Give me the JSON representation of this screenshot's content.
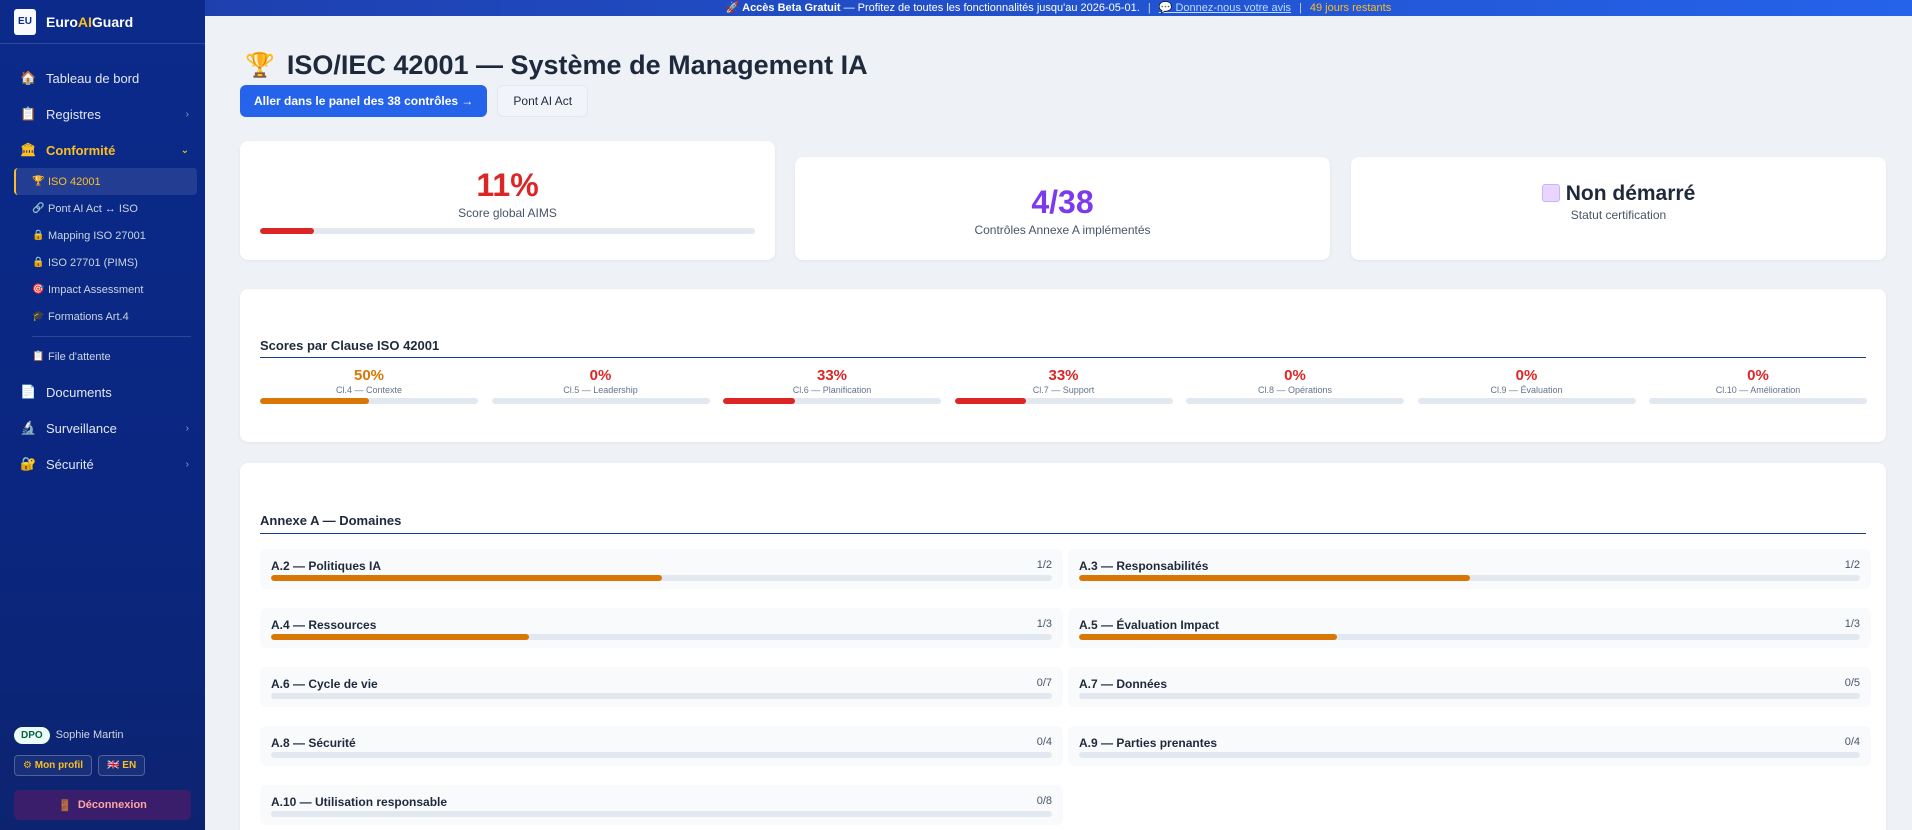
{
  "brand": {
    "logo_text": "EU",
    "name_prefix": "Euro",
    "name_ai": "AI",
    "name_suffix": "Guard"
  },
  "banner": {
    "bold": "🚀 Accès Beta Gratuit",
    "text": " — Profitez de toutes les fonctionnalités jusqu'au 2026-05-01.",
    "sep": "|",
    "feedback_link": "💬 Donnez-nous votre avis",
    "days_left": "49 jours restants"
  },
  "sidebar": {
    "items": [
      {
        "label": "Tableau de bord",
        "icon": "🏠"
      },
      {
        "label": "Registres",
        "icon": "📋"
      },
      {
        "label": "Conformité",
        "icon": "🏛"
      },
      {
        "label": "Documents",
        "icon": "📄"
      },
      {
        "label": "Surveillance",
        "icon": "🔬"
      },
      {
        "label": "Sécurité",
        "icon": "🔐"
      }
    ],
    "sub_items": [
      {
        "label": "ISO 42001",
        "icon": "🏆"
      },
      {
        "label": "Pont AI Act ↔ ISO",
        "icon": "🔗"
      },
      {
        "label": "Mapping ISO 27001",
        "icon": "🔒"
      },
      {
        "label": "ISO 27701 (PIMS)",
        "icon": "🔒"
      },
      {
        "label": "Impact Assessment",
        "icon": "🎯"
      },
      {
        "label": "Formations Art.4",
        "icon": "🎓"
      },
      {
        "label": "File d'attente",
        "icon": "📋"
      }
    ],
    "chevron": "›",
    "chevron_open": "⌄"
  },
  "user": {
    "role": "DPO",
    "name": "Sophie Martin",
    "profile_button": "⚙ Mon profil",
    "lang_button": "🇬🇧 EN",
    "logout_button": "Déconnexion",
    "logout_icon": "🚪"
  },
  "page": {
    "title_icon": "🏆",
    "title": "ISO/IEC 42001 — Système de Management IA",
    "primary_button": "Aller dans le panel des 38 contrôles →",
    "secondary_button": "Pont AI Act"
  },
  "stats": {
    "score": {
      "value": "11%",
      "label": "Score global AIMS",
      "progress": 11,
      "color": "#dc2626"
    },
    "controls": {
      "value": "4/38",
      "label": "Contrôles Annexe A implémentés",
      "color": "#7c3aed"
    },
    "certification": {
      "icon": "⬜",
      "value": "Non démarré",
      "label": "Statut certification"
    }
  },
  "clauses": {
    "title": "Scores par Clause ISO 42001",
    "items": [
      {
        "pct": "50%",
        "label": "Cl.4 — Contexte",
        "value": 50,
        "color": "#d97706"
      },
      {
        "pct": "0%",
        "label": "Cl.5 — Leadership",
        "value": 0,
        "color": "#dc2626"
      },
      {
        "pct": "33%",
        "label": "Cl.6 — Planification",
        "value": 33,
        "color": "#dc2626"
      },
      {
        "pct": "33%",
        "label": "Cl.7 — Support",
        "value": 33,
        "color": "#dc2626"
      },
      {
        "pct": "0%",
        "label": "Cl.8 — Opérations",
        "value": 0,
        "color": "#dc2626"
      },
      {
        "pct": "0%",
        "label": "Cl.9 — Évaluation",
        "value": 0,
        "color": "#dc2626"
      },
      {
        "pct": "0%",
        "label": "Cl.10 — Amélioration",
        "value": 0,
        "color": "#dc2626"
      }
    ]
  },
  "domains": {
    "title": "Annexe A — Domaines",
    "items": [
      {
        "name": "A.2 — Politiques IA",
        "count": "1/2",
        "value": 50
      },
      {
        "name": "A.3 — Responsabilités",
        "count": "1/2",
        "value": 50
      },
      {
        "name": "A.4 — Ressources",
        "count": "1/3",
        "value": 33
      },
      {
        "name": "A.5 — Évaluation Impact",
        "count": "1/3",
        "value": 33
      },
      {
        "name": "A.6 — Cycle de vie",
        "count": "0/7",
        "value": 0
      },
      {
        "name": "A.7 — Données",
        "count": "0/5",
        "value": 0
      },
      {
        "name": "A.8 — Sécurité",
        "count": "0/4",
        "value": 0
      },
      {
        "name": "A.9 — Parties prenantes",
        "count": "0/4",
        "value": 0
      },
      {
        "name": "A.10 — Utilisation responsable",
        "count": "0/8",
        "value": 0
      }
    ],
    "fill_color": "#d97706"
  }
}
